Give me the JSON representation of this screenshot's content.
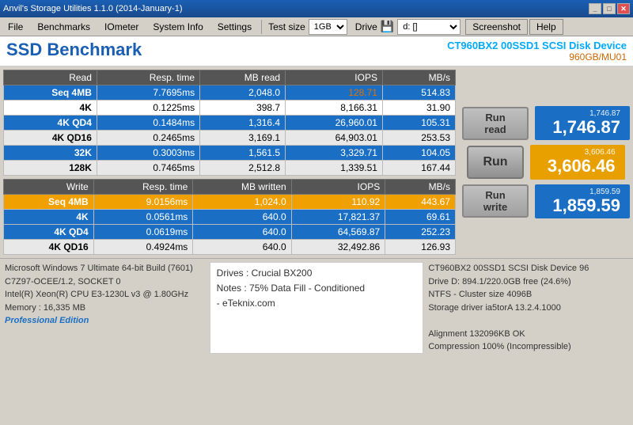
{
  "titleBar": {
    "title": "Anvil's Storage Utilities 1.1.0 (2014-January-1)"
  },
  "menu": {
    "file": "File",
    "benchmarks": "Benchmarks",
    "iometer": "IOmeter",
    "systemInfo": "System Info",
    "settings": "Settings",
    "testSizeLabel": "Test size",
    "testSizeValue": "1GB",
    "driveLabel": "Drive",
    "driveValue": "d: []",
    "screenshot": "Screenshot",
    "help": "Help"
  },
  "header": {
    "title": "SSD Benchmark",
    "deviceName": "CT960BX2 00SSD1 SCSI Disk Device",
    "deviceModel": "960GB/MU01"
  },
  "readTable": {
    "headers": [
      "Read",
      "Resp. time",
      "MB read",
      "IOPS",
      "MB/s"
    ],
    "rows": [
      [
        "Seq 4MB",
        "7.7695ms",
        "2,048.0",
        "128.71",
        "514.83"
      ],
      [
        "4K",
        "0.1225ms",
        "398.7",
        "8,166.31",
        "31.90"
      ],
      [
        "4K QD4",
        "0.1484ms",
        "1,316.4",
        "26,960.01",
        "105.31"
      ],
      [
        "4K QD16",
        "0.2465ms",
        "3,169.1",
        "64,903.01",
        "253.53"
      ],
      [
        "32K",
        "0.3003ms",
        "1,561.5",
        "3,329.71",
        "104.05"
      ],
      [
        "128K",
        "0.7465ms",
        "2,512.8",
        "1,339.51",
        "167.44"
      ]
    ]
  },
  "writeTable": {
    "headers": [
      "Write",
      "Resp. time",
      "MB written",
      "IOPS",
      "MB/s"
    ],
    "rows": [
      [
        "Seq 4MB",
        "9.0156ms",
        "1,024.0",
        "110.92",
        "443.67"
      ],
      [
        "4K",
        "0.0561ms",
        "640.0",
        "17,821.37",
        "69.61"
      ],
      [
        "4K QD4",
        "0.0619ms",
        "640.0",
        "64,569.87",
        "252.23"
      ],
      [
        "4K QD16",
        "0.4924ms",
        "640.0",
        "32,492.86",
        "126.93"
      ]
    ]
  },
  "scores": {
    "readSmall": "1,746.87",
    "readLarge": "1,746.87",
    "runReadLabel": "Run read",
    "totalSmall": "3,606.46",
    "totalLarge": "3,606.46",
    "runLabel": "Run",
    "writeSmall": "1,859.59",
    "writeLarge": "1,859.59",
    "runWriteLabel": "Run write"
  },
  "bottomBar": {
    "sysInfo": [
      "Microsoft Windows 7 Ultimate  64-bit Build (7601)",
      "C7Z97-OCEE/1.2, SOCKET 0",
      "Intel(R) Xeon(R) CPU E3-1230L v3 @ 1.80GHz",
      "Memory : 16,335 MB"
    ],
    "proEdition": "Professional Edition",
    "notes": [
      "Drives : Crucial BX200",
      "Notes : 75% Data Fill - Conditioned",
      "- eTeknix.com"
    ],
    "driveInfo": [
      "CT960BX2 00SSD1 SCSI Disk Device 96",
      "Drive D:  894.1/220.0GB free (24.6%)",
      "NTFS - Cluster size 4096B",
      "Storage driver  ia5torA 13.2.4.1000",
      "",
      "Alignment 132096KB OK",
      "Compression 100% (Incompressible)"
    ]
  }
}
